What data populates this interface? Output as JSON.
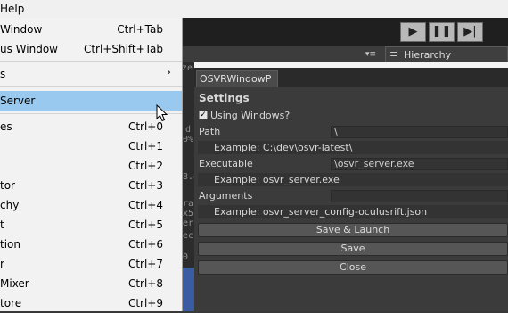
{
  "menubar": {
    "help_label": "Help"
  },
  "toolbar": {
    "play_icon": "play-icon",
    "pause_icon": "pause-icon",
    "step_icon": "step-icon"
  },
  "hierarchy": {
    "tab_label": "Hierarchy"
  },
  "dropdown": {
    "items": [
      {
        "label": "Window",
        "shortcut": "Ctrl+Tab"
      },
      {
        "label": "us Window",
        "shortcut": "Ctrl+Shift+Tab"
      },
      {
        "label": "s",
        "shortcut": "",
        "submenu": true
      },
      {
        "label": "Server",
        "shortcut": "",
        "highlighted": true
      },
      {
        "label": "es",
        "shortcut": "Ctrl+0"
      },
      {
        "label": "",
        "shortcut": "Ctrl+1"
      },
      {
        "label": "",
        "shortcut": "Ctrl+2"
      },
      {
        "label": "tor",
        "shortcut": "Ctrl+3"
      },
      {
        "label": "chy",
        "shortcut": "Ctrl+4"
      },
      {
        "label": "t",
        "shortcut": "Ctrl+5"
      },
      {
        "label": "tion",
        "shortcut": "Ctrl+6"
      },
      {
        "label": "r",
        "shortcut": "Ctrl+7"
      },
      {
        "label": "Mixer",
        "shortcut": "Ctrl+8"
      },
      {
        "label": "tore",
        "shortcut": "Ctrl+9"
      }
    ]
  },
  "osvr": {
    "tab_title": "OSVRWindowP",
    "settings_heading": "Settings",
    "using_windows_label": "Using Windows?",
    "using_windows_checked": true,
    "path_label": "Path",
    "path_value": "\\",
    "path_example": "Example:  C:\\dev\\osvr-latest\\",
    "executable_label": "Executable",
    "executable_value": "\\osvr_server.exe",
    "executable_example": "Example:  osvr_server.exe",
    "arguments_label": "Arguments",
    "arguments_value": "",
    "arguments_example": "Example:  osvr_server_config-oculusrift.json",
    "save_launch_label": "Save & Launch",
    "save_label": "Save",
    "close_label": "Close"
  },
  "background_fragments": [
    "ze",
    "d",
    "0%",
    "8.4",
    "ra",
    "x5",
    "er",
    "ec",
    "0 ["
  ]
}
